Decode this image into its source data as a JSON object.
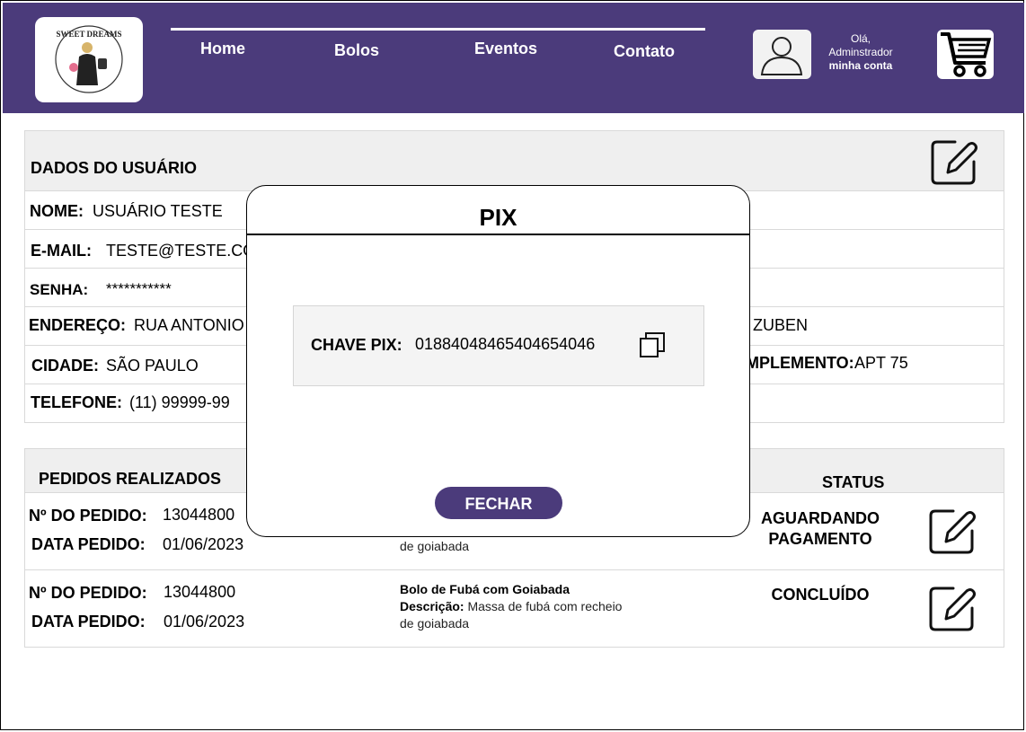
{
  "header": {
    "logo_alt": "Sweet Dreams",
    "nav": [
      "Home",
      "Bolos",
      "Eventos",
      "Contato"
    ],
    "greeting_line1": "Olá,",
    "greeting_line2": "Adminstrador",
    "account_link": "minha conta",
    "accent": "#4b3b7b"
  },
  "user_panel": {
    "title": "DADOS DO USUÁRIO",
    "name_label": "NOME:",
    "name_value": "USUÁRIO TESTE",
    "email_label": "E-MAIL:",
    "email_value": "TESTE@TESTE.COM",
    "password_label": "SENHA:",
    "password_value": "***********",
    "address_label": "ENDEREÇO:",
    "address_value": "RUA ANTONIO",
    "address_tail": "ZUBEN",
    "city_label": "CIDADE:",
    "city_value": "SÃO PAULO",
    "complement_label": "MPLEMENTO:",
    "complement_value": "APT 75",
    "phone_label": "TELEFONE:",
    "phone_value": "(11) 99999-99"
  },
  "orders": {
    "title": "PEDIDOS REALIZADOS",
    "status_header": "STATUS",
    "items": [
      {
        "number_label": "Nº DO PEDIDO:",
        "number": "13044800",
        "date_label": "DATA PEDIDO:",
        "date": "01/06/2023",
        "desc_tail": "de goiabada",
        "status": "AGUARDANDO PAGAMENTO"
      },
      {
        "number_label": "Nº DO PEDIDO:",
        "number": "13044800",
        "date_label": "DATA PEDIDO:",
        "date": "01/06/2023",
        "product": "Bolo de Fubá com Goiabada",
        "desc_label": "Descrição:",
        "desc": "Massa de fubá com recheio",
        "desc_tail": "de goiabada",
        "status": "CONCLUÍDO"
      }
    ]
  },
  "modal": {
    "title": "PIX",
    "key_label": "CHAVE PIX:",
    "key_value": "01884048465404654046",
    "close_label": "FECHAR"
  }
}
